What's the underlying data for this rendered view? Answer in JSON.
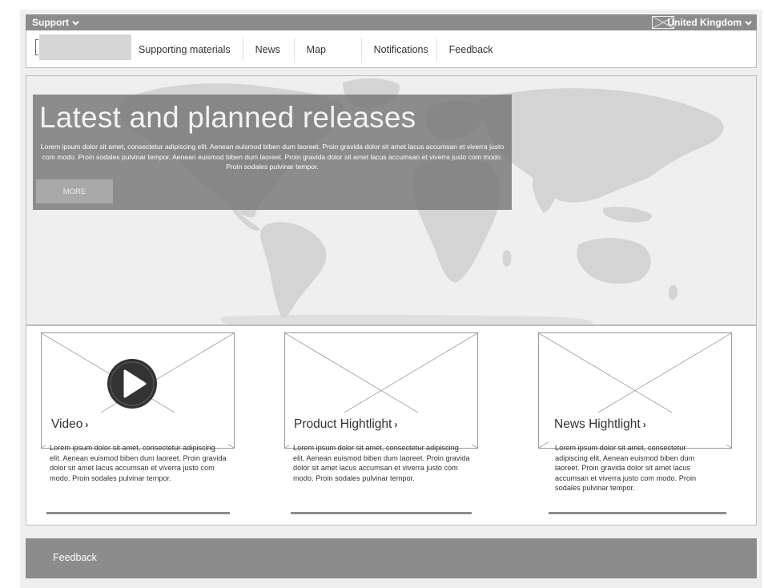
{
  "topbar": {
    "support_label": "Support",
    "country_label": "United Kingdom"
  },
  "nav": {
    "items": [
      {
        "label": "Supporting materials"
      },
      {
        "label": "News"
      },
      {
        "label": "Map"
      },
      {
        "label": "Notifications"
      },
      {
        "label": "Feedback"
      }
    ]
  },
  "hero": {
    "title": "Latest and planned releases",
    "body": "Lorem ipsum dolor sit amet, consectetur adipiscing elit. Aenean euismod biben dum laoreet. Proin gravida dolor sit amet lacus accumsan et viverra justo com modo. Proin sodales pulvinar tempor. Aenean euismod biben dum laoreet. Proin gravida dolor sit amet lacus accumsan et viverra justo com modo. Proin sodales pulvinar tempor.",
    "more_label": "MORE"
  },
  "cards": [
    {
      "title": "Video",
      "text": "Lorem ipsum dolor sit amet, consectetur adipiscing elit. Aenean euismod biben dum laoreet. Proin gravida dolor sit amet lacus accumsan et viverra justo com modo. Proin sodales pulvinar tempor."
    },
    {
      "title": "Product Hightlight",
      "text": "Lorem ipsum dolor sit amet, consectetur adipiscing elit. Aenean euismod biben dum laoreet. Proin gravida dolor sit amet lacus accumsan et viverra justo com modo. Proin sodales pulvinar tempor."
    },
    {
      "title": "News Hightlight",
      "text": "Lorem ipsum dolor sit amet, consectetur adipiscing elit. Aenean euismod biben dum laoreet. Proin gravida dolor sit amet lacus accumsan et viverra justo com modo. Proin sodales pulvinar tempor."
    }
  ],
  "footer": {
    "link_label": "Feedback"
  },
  "icons": {
    "support_chevron": "chevron-down-icon",
    "country_chevron": "chevron-down-icon",
    "flag": "flag-icon",
    "play": "play-icon",
    "card_arrow": "chevron-right-icon"
  },
  "colors": {
    "topbar": "#8c8c8c",
    "footer": "#8c8c8c",
    "hero_panel": "#767676",
    "map_land": "#d0d0d0",
    "background": "#efefef"
  }
}
